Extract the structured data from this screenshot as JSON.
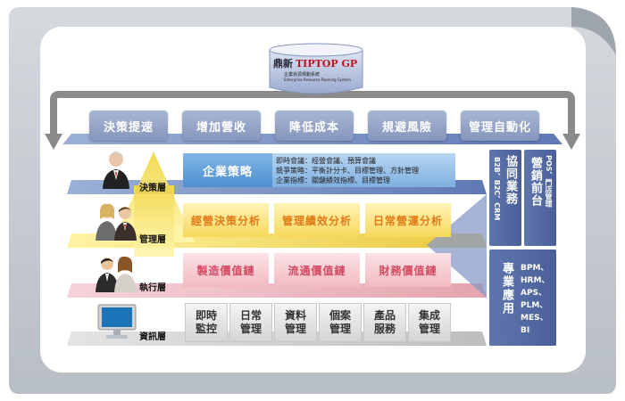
{
  "logo": {
    "brand_cn": "鼎新",
    "product": "TIPTOP GP",
    "subtitle_cn": "企業資源規劃系統",
    "subtitle_en": "Enterprise Resource Planning System"
  },
  "goals": [
    "決策提速",
    "增加營收",
    "降低成本",
    "規避風險",
    "管理自動化"
  ],
  "levels": {
    "decision": {
      "label": "決策層",
      "strategy": "企業策略",
      "details": [
        "即時會議：經營會議、預算會議",
        "競爭策略：平衡計分卡、目標管理、方針管理",
        "企業指標：關鍵績效指標、目標管理"
      ]
    },
    "management": {
      "label": "管理層",
      "items": [
        "經營決策分析",
        "管理績效分析",
        "日常營運分析"
      ]
    },
    "execution": {
      "label": "執行層",
      "items": [
        "製造價值鏈",
        "流通價值鏈",
        "財務價值鏈"
      ]
    },
    "information": {
      "label": "資訊層",
      "items": [
        "即時\n監控",
        "日常\n管理",
        "資料\n管理",
        "個案\n管理",
        "產品\n服務",
        "集成\n管理"
      ]
    }
  },
  "side": {
    "collab_title": "協同業務",
    "collab_detail": "B2B、B2C、CRM",
    "pos_title": "營銷前台",
    "pos_detail": "POS、門店管理",
    "pro_title": "專業應用",
    "pro_items": [
      "BPM、",
      "HRM、",
      "APS、",
      "PLM、",
      "MES、",
      "BI"
    ]
  },
  "colors": {
    "goal": "#8596bd",
    "strategy": "#4e8fd0",
    "analysis": "#f7d85c",
    "value_chain": "#f2b9c1",
    "info": "#d4d4d4",
    "side": "#4a5f98",
    "arrow": "#8a8a8a"
  }
}
